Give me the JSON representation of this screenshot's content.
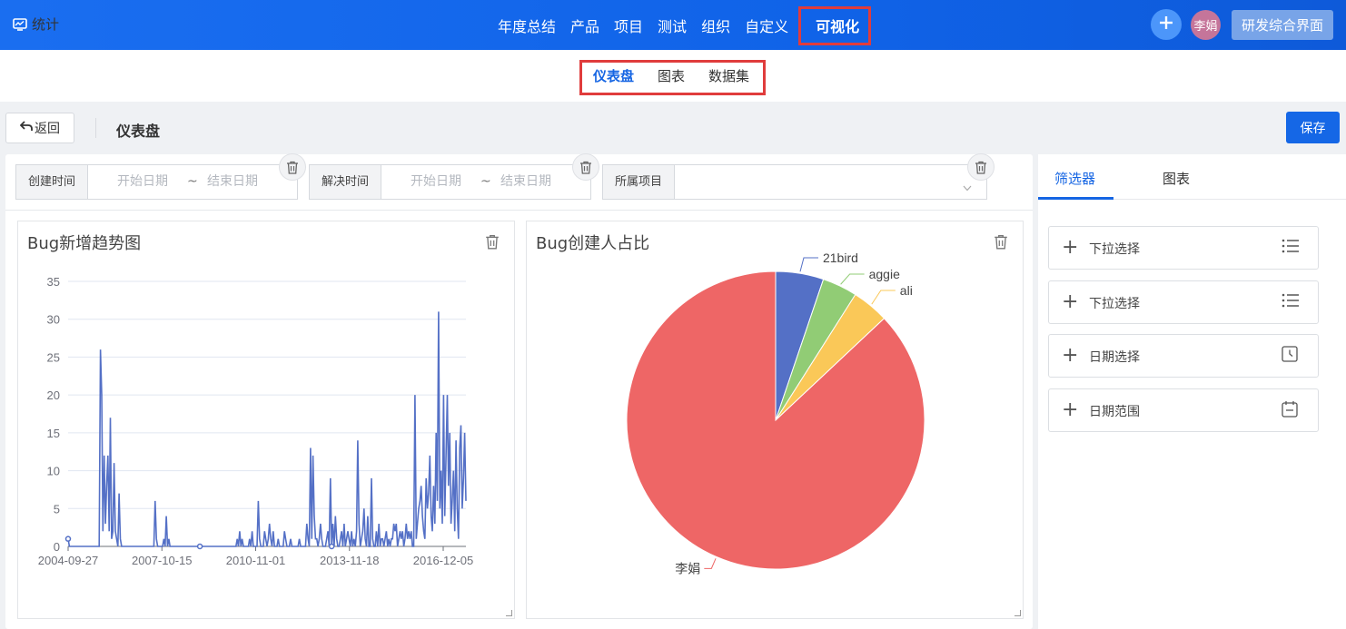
{
  "header": {
    "brand": "统计",
    "nav": [
      "年度总结",
      "产品",
      "项目",
      "测试",
      "组织",
      "自定义",
      "可视化"
    ],
    "active_nav": "可视化",
    "avatar_text": "李娟",
    "switch_label": "研发综合界面"
  },
  "subnav": {
    "items": [
      "仪表盘",
      "图表",
      "数据集"
    ],
    "active": "仪表盘"
  },
  "toolbar": {
    "back_label": "返回",
    "title": "仪表盘",
    "save_label": "保存"
  },
  "filters": [
    {
      "label": "创建时间",
      "start_placeholder": "开始日期",
      "sep": "~",
      "end_placeholder": "结束日期"
    },
    {
      "label": "解决时间",
      "start_placeholder": "开始日期",
      "sep": "~",
      "end_placeholder": "结束日期"
    },
    {
      "label": "所属项目",
      "value": ""
    }
  ],
  "right_panel": {
    "tabs": [
      "筛选器",
      "图表"
    ],
    "active_tab": "筛选器",
    "widgets": [
      {
        "label": "下拉选择",
        "icon": "list-icon"
      },
      {
        "label": "下拉选择",
        "icon": "list-icon"
      },
      {
        "label": "日期选择",
        "icon": "clock-icon"
      },
      {
        "label": "日期范围",
        "icon": "calendar-icon"
      }
    ]
  },
  "colors": {
    "primary": "#1565e3",
    "line": "#5470c6",
    "pie_red": "#ee6666",
    "pie_blue": "#5470c6",
    "pie_green": "#91cc75",
    "pie_yellow": "#fac858"
  },
  "chart_data": [
    {
      "type": "line",
      "title": "Bug新增趋势图",
      "xlabel": "",
      "ylabel": "",
      "ylim": [
        0,
        35
      ],
      "yticks": [
        0,
        5,
        10,
        15,
        20,
        25,
        30,
        35
      ],
      "xticks": [
        "2004-09-27",
        "2007-10-15",
        "2010-11-01",
        "2013-11-18",
        "2016-12-05"
      ],
      "series": [
        {
          "values": [
            1,
            0,
            0,
            0,
            0,
            0,
            0,
            0,
            0,
            0,
            0,
            0,
            0,
            0,
            0,
            0,
            0,
            0,
            0,
            0,
            0,
            0,
            0,
            0,
            0,
            0,
            26,
            20,
            2,
            12,
            3,
            8,
            12,
            2,
            17,
            1,
            2,
            11,
            2,
            1,
            0,
            7,
            1,
            0,
            0,
            0,
            0,
            0,
            0,
            0,
            0,
            0,
            0,
            0,
            0,
            0,
            0,
            0,
            0,
            0,
            0,
            0,
            0,
            0,
            0,
            0,
            0,
            0,
            0,
            0,
            6,
            1,
            0,
            0,
            0,
            0,
            0,
            1,
            0,
            4,
            0,
            1,
            0,
            0,
            0,
            0,
            0,
            0,
            0,
            0,
            0,
            0,
            0,
            0,
            0,
            0,
            0,
            0,
            0,
            0,
            0,
            0,
            0,
            0,
            0,
            0,
            0,
            0,
            0,
            0,
            0,
            0,
            0,
            0,
            0,
            0,
            0,
            0,
            0,
            0,
            0,
            0,
            0,
            0,
            0,
            0,
            0,
            0,
            0,
            0,
            0,
            0,
            0,
            0,
            0,
            0,
            1,
            0,
            2,
            0,
            1,
            0,
            0,
            0,
            0,
            0,
            1,
            0,
            2,
            0,
            0,
            0,
            0,
            6,
            1,
            0,
            0,
            0,
            2,
            1,
            0,
            1,
            3,
            1,
            0,
            2,
            0,
            0,
            0,
            1,
            0,
            0,
            0,
            0,
            2,
            1,
            0,
            0,
            0,
            1,
            0,
            0,
            0,
            0,
            0,
            0,
            1,
            0,
            0,
            0,
            0,
            0,
            3,
            1,
            0,
            13,
            1,
            12,
            4,
            1,
            1,
            0,
            1,
            3,
            1,
            0,
            0,
            0,
            1,
            2,
            0,
            9,
            0,
            3,
            0,
            4,
            1,
            0,
            0,
            1,
            2,
            0,
            3,
            0,
            1,
            2,
            1,
            0,
            2,
            0,
            1,
            0,
            2,
            14,
            3,
            0,
            1,
            2,
            5,
            1,
            0,
            4,
            0,
            0,
            9,
            1,
            0,
            0,
            2,
            0,
            3,
            0,
            1,
            1,
            0,
            1,
            2,
            0,
            1,
            0,
            1,
            1,
            3,
            2,
            3,
            0,
            1,
            2,
            1,
            2,
            0,
            1,
            3,
            1,
            2,
            1,
            2,
            0,
            0,
            20,
            1,
            3,
            5,
            6,
            8,
            4,
            2,
            1,
            9,
            5,
            7,
            12,
            4,
            2,
            8,
            3,
            15,
            6,
            31,
            5,
            10,
            3,
            20,
            4,
            12,
            20,
            8,
            15,
            3,
            6,
            10,
            2,
            14,
            5,
            1,
            13,
            16,
            5,
            9,
            15,
            6
          ]
        }
      ]
    },
    {
      "type": "pie",
      "title": "Bug创建人占比",
      "categories": [
        "李娟",
        "21bird",
        "aggie",
        "ali"
      ],
      "values": [
        87,
        5.2,
        3.8,
        4.0
      ]
    }
  ]
}
